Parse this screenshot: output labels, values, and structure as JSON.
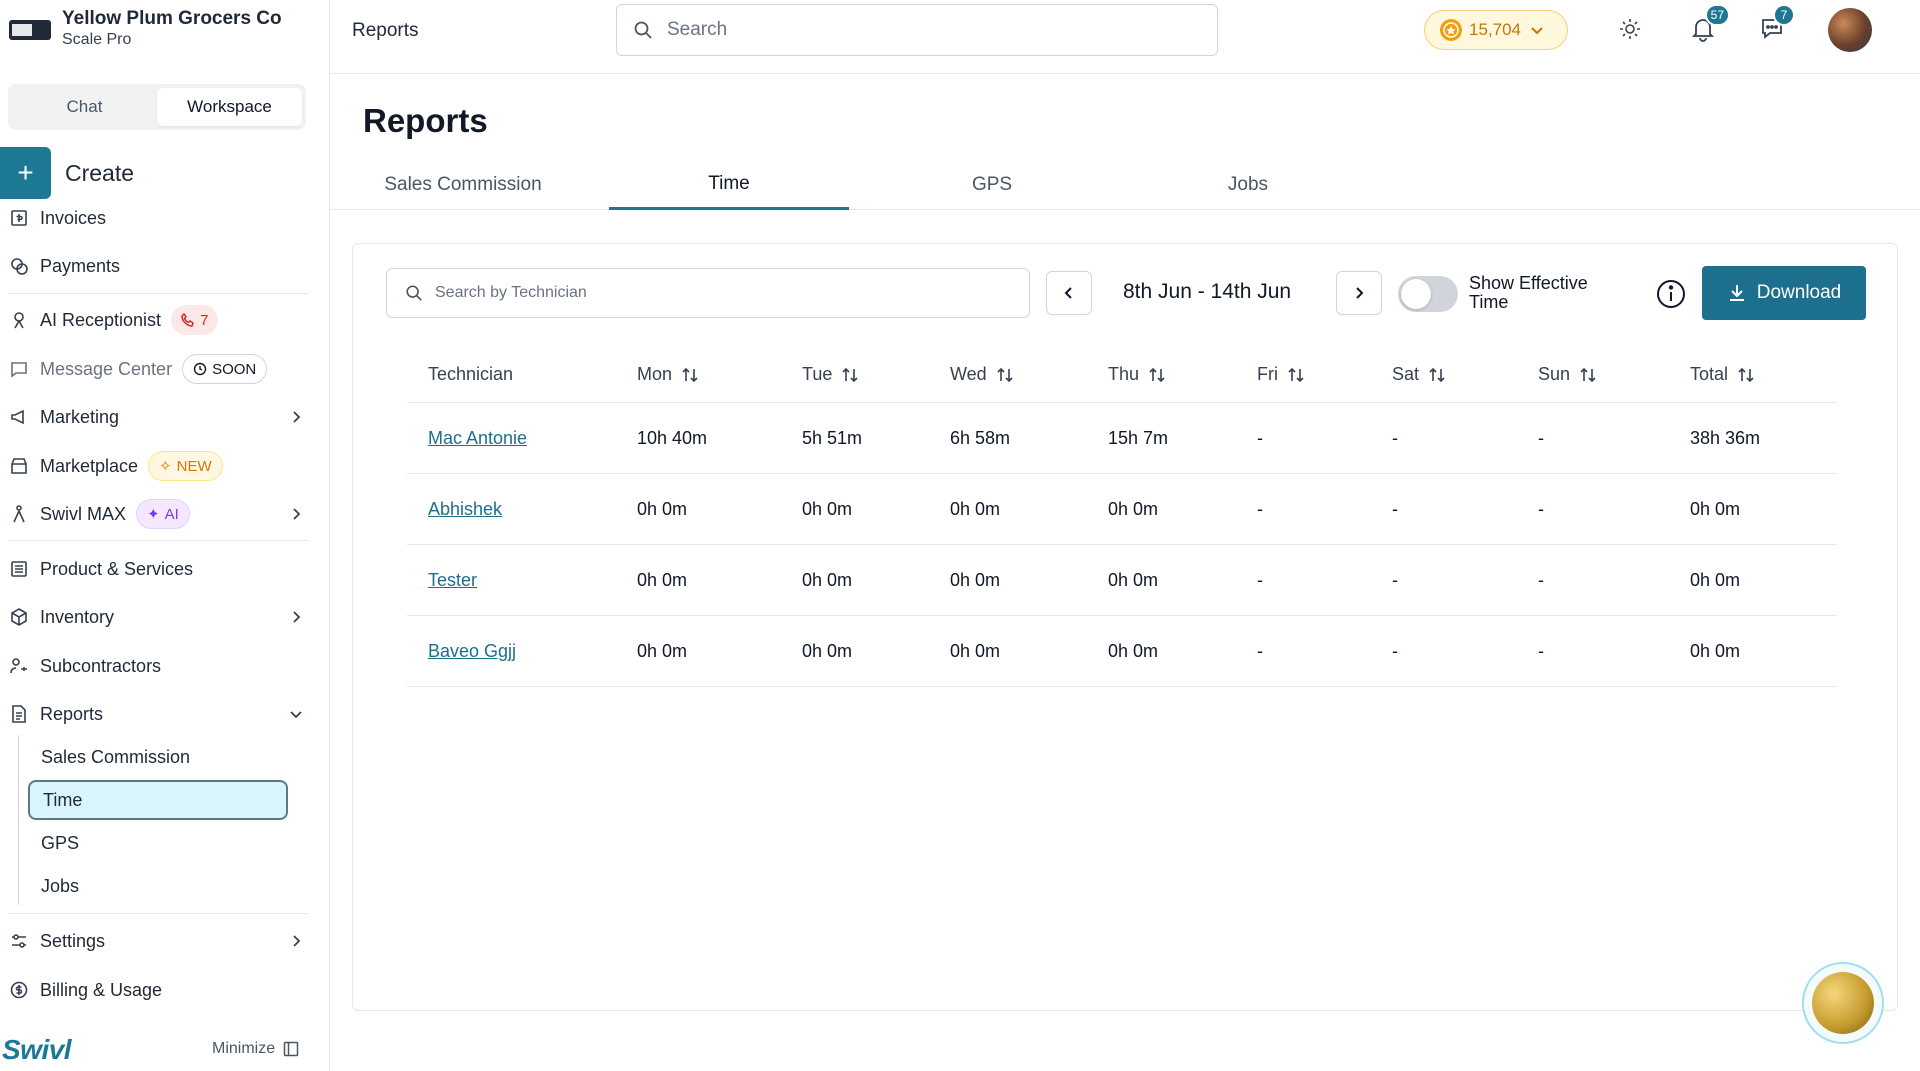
{
  "org": {
    "name": "Yellow Plum Grocers Co",
    "plan": "Scale Pro"
  },
  "mode_tabs": {
    "chat": "Chat",
    "workspace": "Workspace"
  },
  "create_label": "Create",
  "nav": {
    "invoices": "Invoices",
    "payments": "Payments",
    "ai_receptionist": "AI Receptionist",
    "ai_receptionist_badge": "7",
    "message_center": "Message Center",
    "message_center_badge": "SOON",
    "marketing": "Marketing",
    "marketplace": "Marketplace",
    "marketplace_badge": "NEW",
    "swivl_max": "Swivl MAX",
    "swivl_max_badge": "AI",
    "products": "Product & Services",
    "inventory": "Inventory",
    "subcontractors": "Subcontractors",
    "reports": "Reports",
    "reports_sub": [
      "Sales Commission",
      "Time",
      "GPS",
      "Jobs"
    ],
    "settings": "Settings",
    "billing": "Billing & Usage"
  },
  "brand": "Swivl",
  "minimize_label": "Minimize",
  "topbar": {
    "breadcrumb": "Reports",
    "search_placeholder": "Search",
    "coins": "15,704",
    "notifications_count": "57",
    "messages_count": "7"
  },
  "page": {
    "title": "Reports",
    "tabs": [
      "Sales Commission",
      "Time",
      "GPS",
      "Jobs"
    ],
    "active_tab": "Time"
  },
  "toolbar": {
    "search_placeholder": "Search by Technician",
    "date_range": "8th Jun - 14th Jun",
    "toggle_label": "Show Effective Time",
    "download_label": "Download"
  },
  "table": {
    "columns": [
      "Technician",
      "Mon",
      "Tue",
      "Wed",
      "Thu",
      "Fri",
      "Sat",
      "Sun",
      "Total"
    ],
    "rows": [
      [
        "Mac Antonie",
        "10h 40m",
        "5h 51m",
        "6h 58m",
        "15h 7m",
        "-",
        "-",
        "-",
        "38h 36m"
      ],
      [
        "Abhishek",
        "0h 0m",
        "0h 0m",
        "0h 0m",
        "0h 0m",
        "-",
        "-",
        "-",
        "0h 0m"
      ],
      [
        "Tester",
        "0h 0m",
        "0h 0m",
        "0h 0m",
        "0h 0m",
        "-",
        "-",
        "-",
        "0h 0m"
      ],
      [
        "Baveo Ggjj",
        "0h 0m",
        "0h 0m",
        "0h 0m",
        "0h 0m",
        "-",
        "-",
        "-",
        "0h 0m"
      ]
    ]
  },
  "colors": {
    "accent": "#1d7894",
    "button": "#1d6f8e",
    "active_sub_bg": "#d9f5fb"
  }
}
